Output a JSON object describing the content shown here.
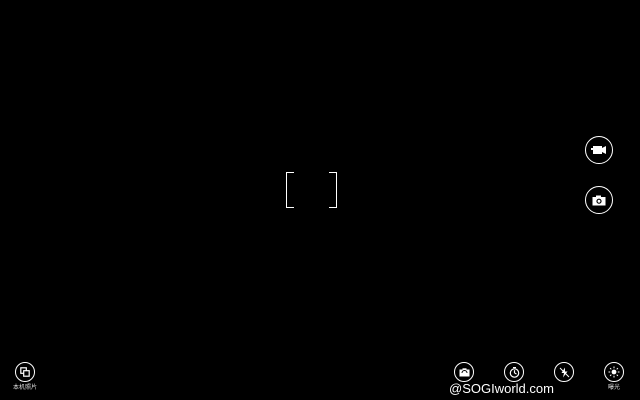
{
  "app": {
    "background": "#000000",
    "accent": "#ffffff"
  },
  "side_controls": {
    "video_icon": "video-camera-icon",
    "photo_icon": "camera-icon"
  },
  "bottom_bar": {
    "camera_roll": {
      "icon": "camera-roll-icon",
      "label": "本机照片"
    },
    "change_camera": {
      "icon": "change-camera-icon"
    },
    "timer": {
      "icon": "timer-icon"
    },
    "flash": {
      "icon": "flash-icon"
    },
    "exposure": {
      "icon": "exposure-icon",
      "label": "曝光"
    }
  },
  "watermark": "@SOGIworld.com"
}
